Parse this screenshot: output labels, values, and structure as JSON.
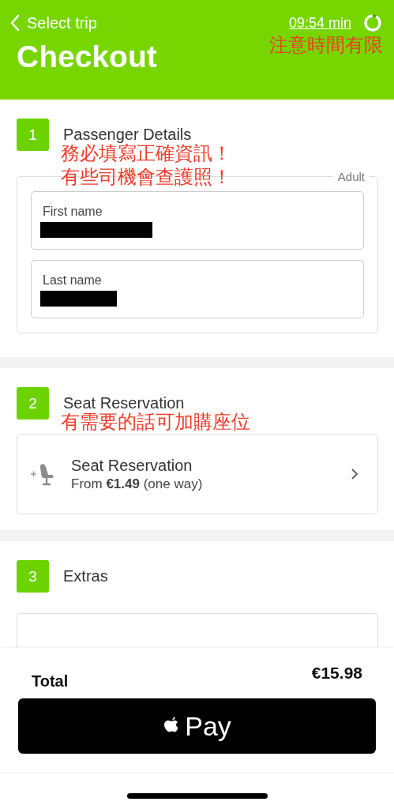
{
  "header": {
    "back_label": "Select trip",
    "timer": "09:54 min",
    "timer_ring": {
      "level": 0.92
    },
    "annotation": "注意時間有限",
    "title": "Checkout"
  },
  "sections": [
    {
      "number": "1",
      "title": "Passenger Details",
      "annotation": [
        "務必填寫正確資訊！",
        "有些司機會查護照！"
      ],
      "kind": "passenger",
      "group_label": "Adult",
      "fields": [
        {
          "label": "First name",
          "redacted": true
        },
        {
          "label": "Last name",
          "redacted": true
        }
      ]
    },
    {
      "number": "2",
      "title": "Seat Reservation",
      "annotation": [
        "有需要的話可加購座位"
      ],
      "kind": "option",
      "option": {
        "title": "Seat Reservation",
        "subtitle": "From **€1.49** (one way)"
      }
    },
    {
      "number": "3",
      "title": "Extras",
      "kind": "extras"
    }
  ],
  "footer": {
    "total_label": "Total",
    "total_value": "€15.98",
    "pay_button": "Pay"
  }
}
